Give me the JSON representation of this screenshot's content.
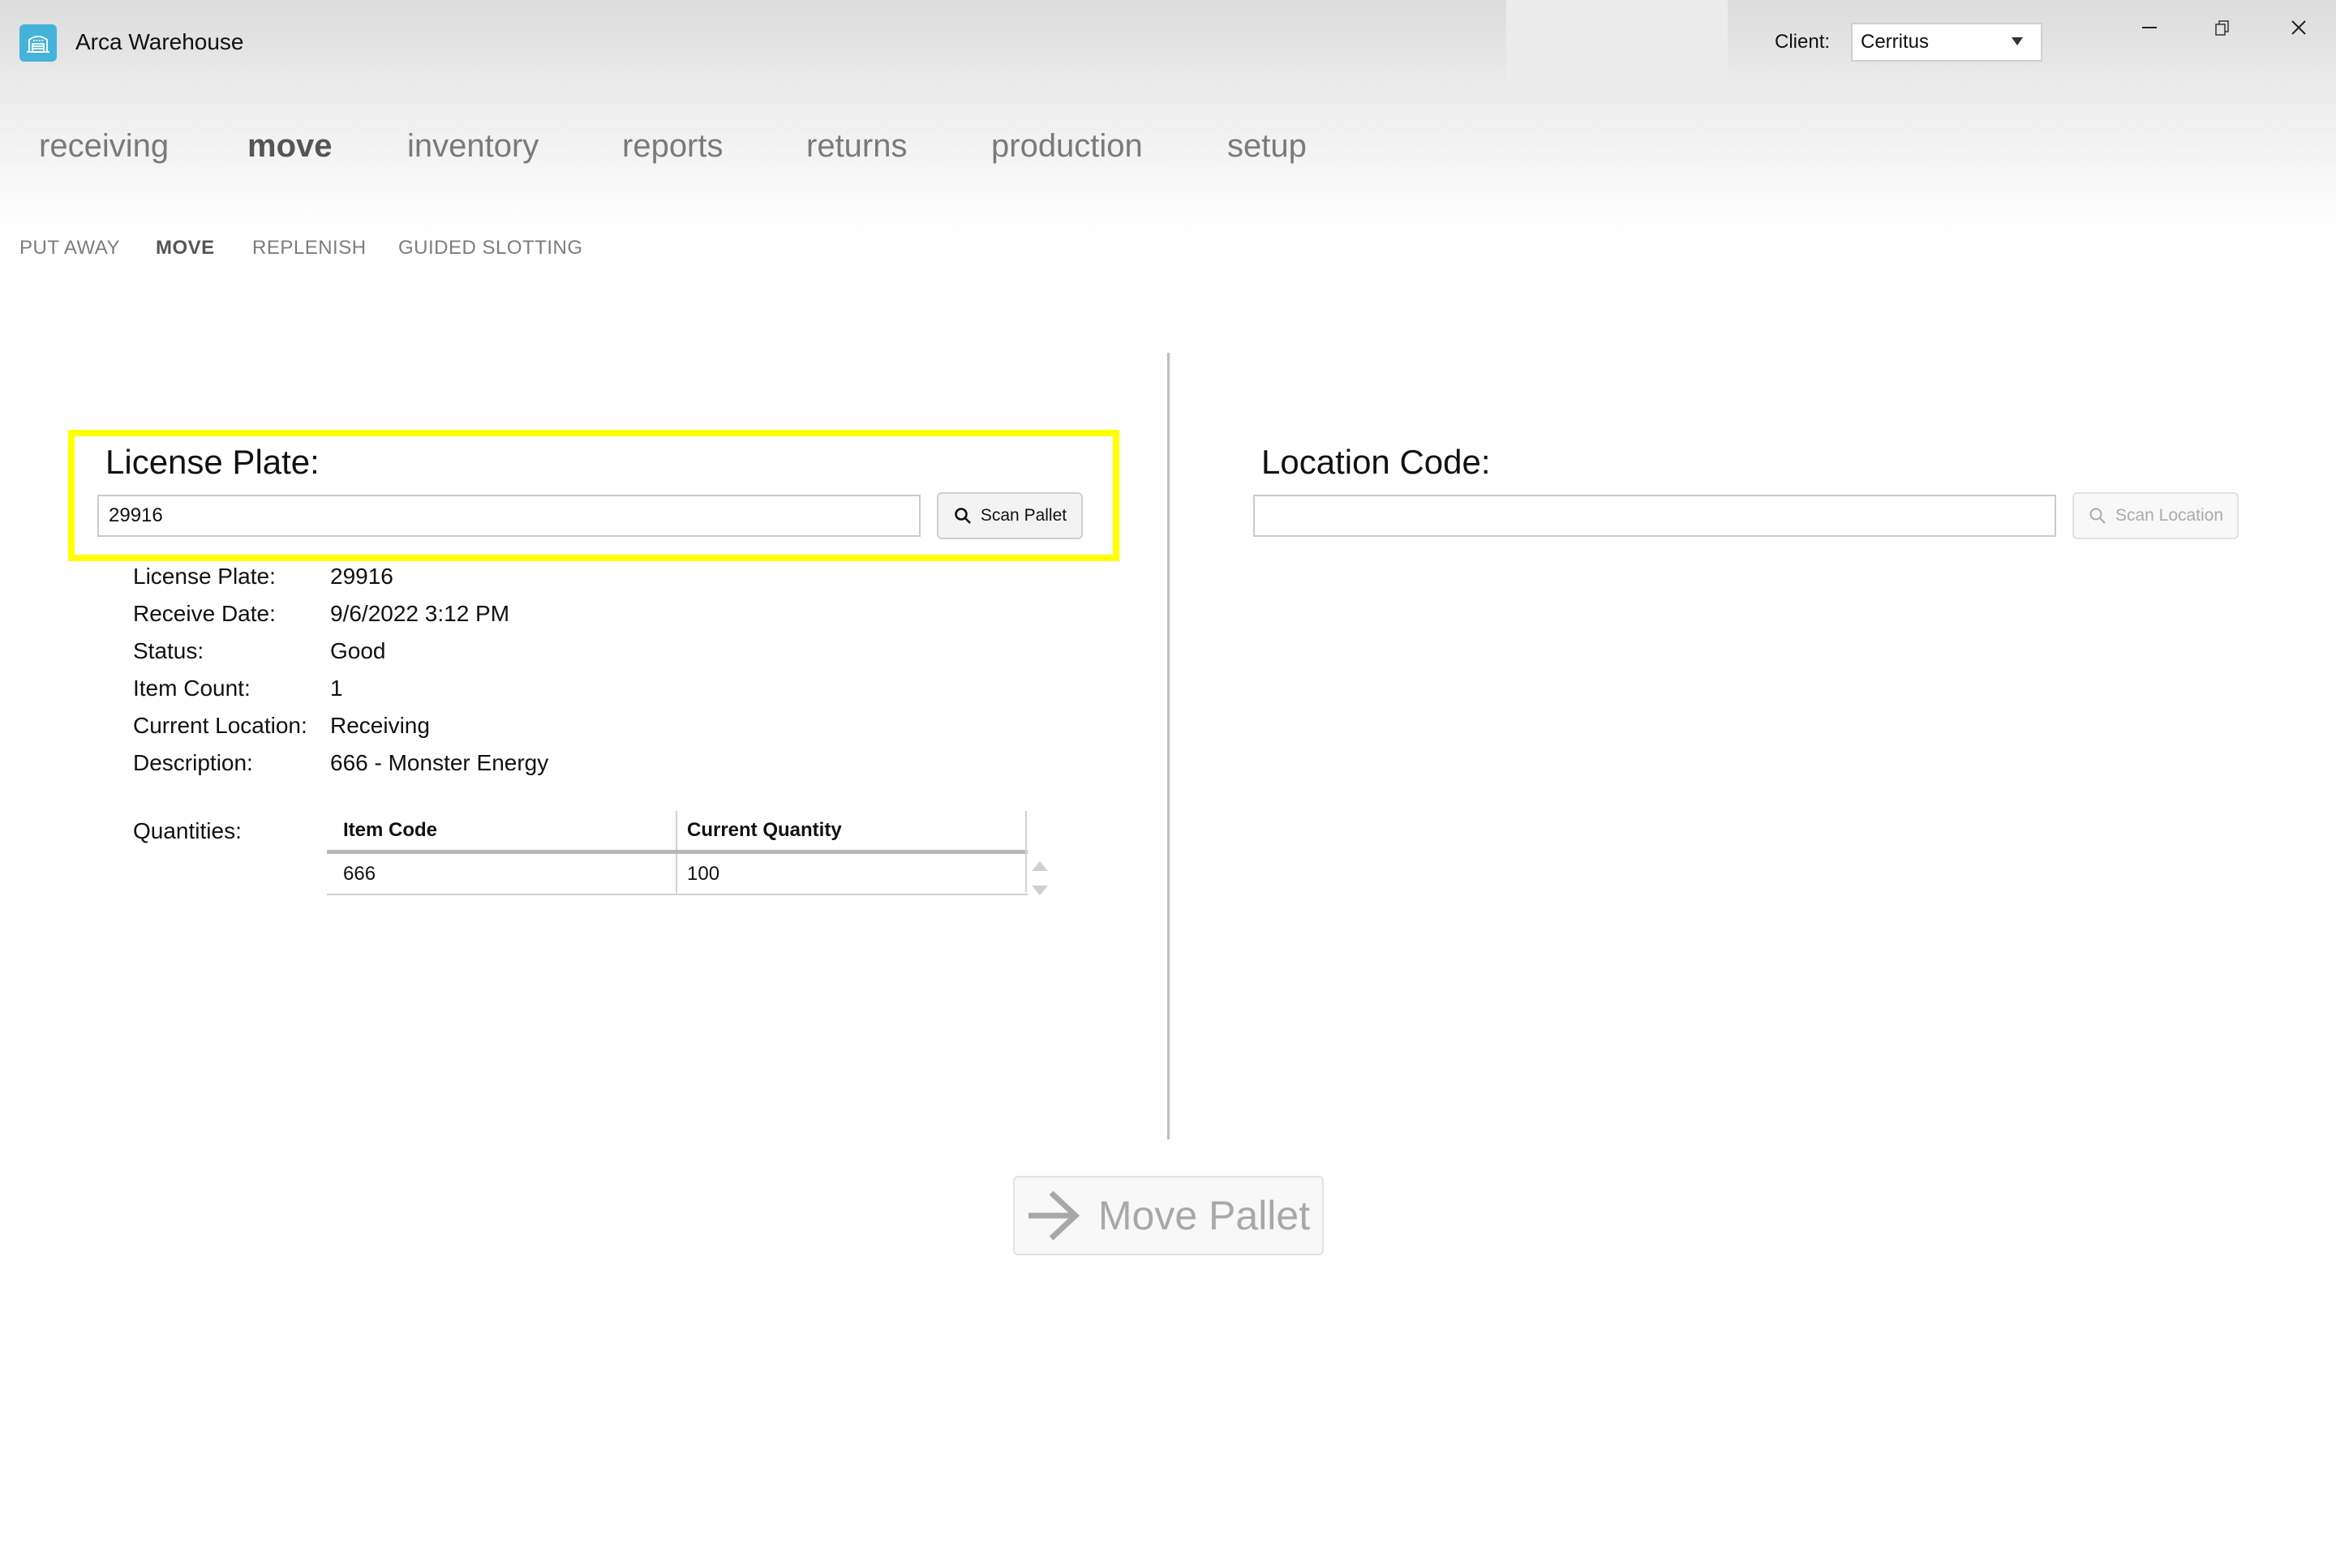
{
  "app": {
    "title": "Arca Warehouse",
    "logo_icon": "warehouse-icon",
    "accent_color": "#45b3d9"
  },
  "client": {
    "label": "Client:",
    "selected": "Cerritus"
  },
  "window_controls": {
    "minimize": "minimize-icon",
    "restore": "restore-icon",
    "close": "close-icon"
  },
  "nav": {
    "items": [
      {
        "label": "receiving",
        "active": false
      },
      {
        "label": "move",
        "active": true
      },
      {
        "label": "inventory",
        "active": false
      },
      {
        "label": "reports",
        "active": false
      },
      {
        "label": "returns",
        "active": false
      },
      {
        "label": "production",
        "active": false
      },
      {
        "label": "setup",
        "active": false
      }
    ]
  },
  "subnav": {
    "items": [
      {
        "label": "PUT AWAY",
        "active": false
      },
      {
        "label": "MOVE",
        "active": true
      },
      {
        "label": "REPLENISH",
        "active": false
      },
      {
        "label": "GUIDED SLOTTING",
        "active": false
      }
    ]
  },
  "license_plate": {
    "title": "License Plate:",
    "value": "29916",
    "placeholder": "",
    "scan_button": "Scan Pallet",
    "highlight_color": "#ffff00"
  },
  "details": [
    {
      "label": "License Plate:",
      "value": "29916"
    },
    {
      "label": "Receive Date:",
      "value": "9/6/2022 3:12 PM"
    },
    {
      "label": "Status:",
      "value": "Good"
    },
    {
      "label": "Item Count:",
      "value": "1"
    },
    {
      "label": "Current Location:",
      "value": "Receiving"
    },
    {
      "label": "Description:",
      "value": "666 - Monster Energy"
    }
  ],
  "quantities": {
    "label": "Quantities:",
    "columns": [
      "Item Code",
      "Current Quantity"
    ],
    "rows": [
      [
        "666",
        "100"
      ]
    ]
  },
  "location_code": {
    "title": "Location Code:",
    "value": "",
    "placeholder": "",
    "scan_button": "Scan Location",
    "scan_enabled": false
  },
  "move_pallet": {
    "label": "Move Pallet",
    "icon": "arrow-right-icon",
    "enabled": false
  }
}
